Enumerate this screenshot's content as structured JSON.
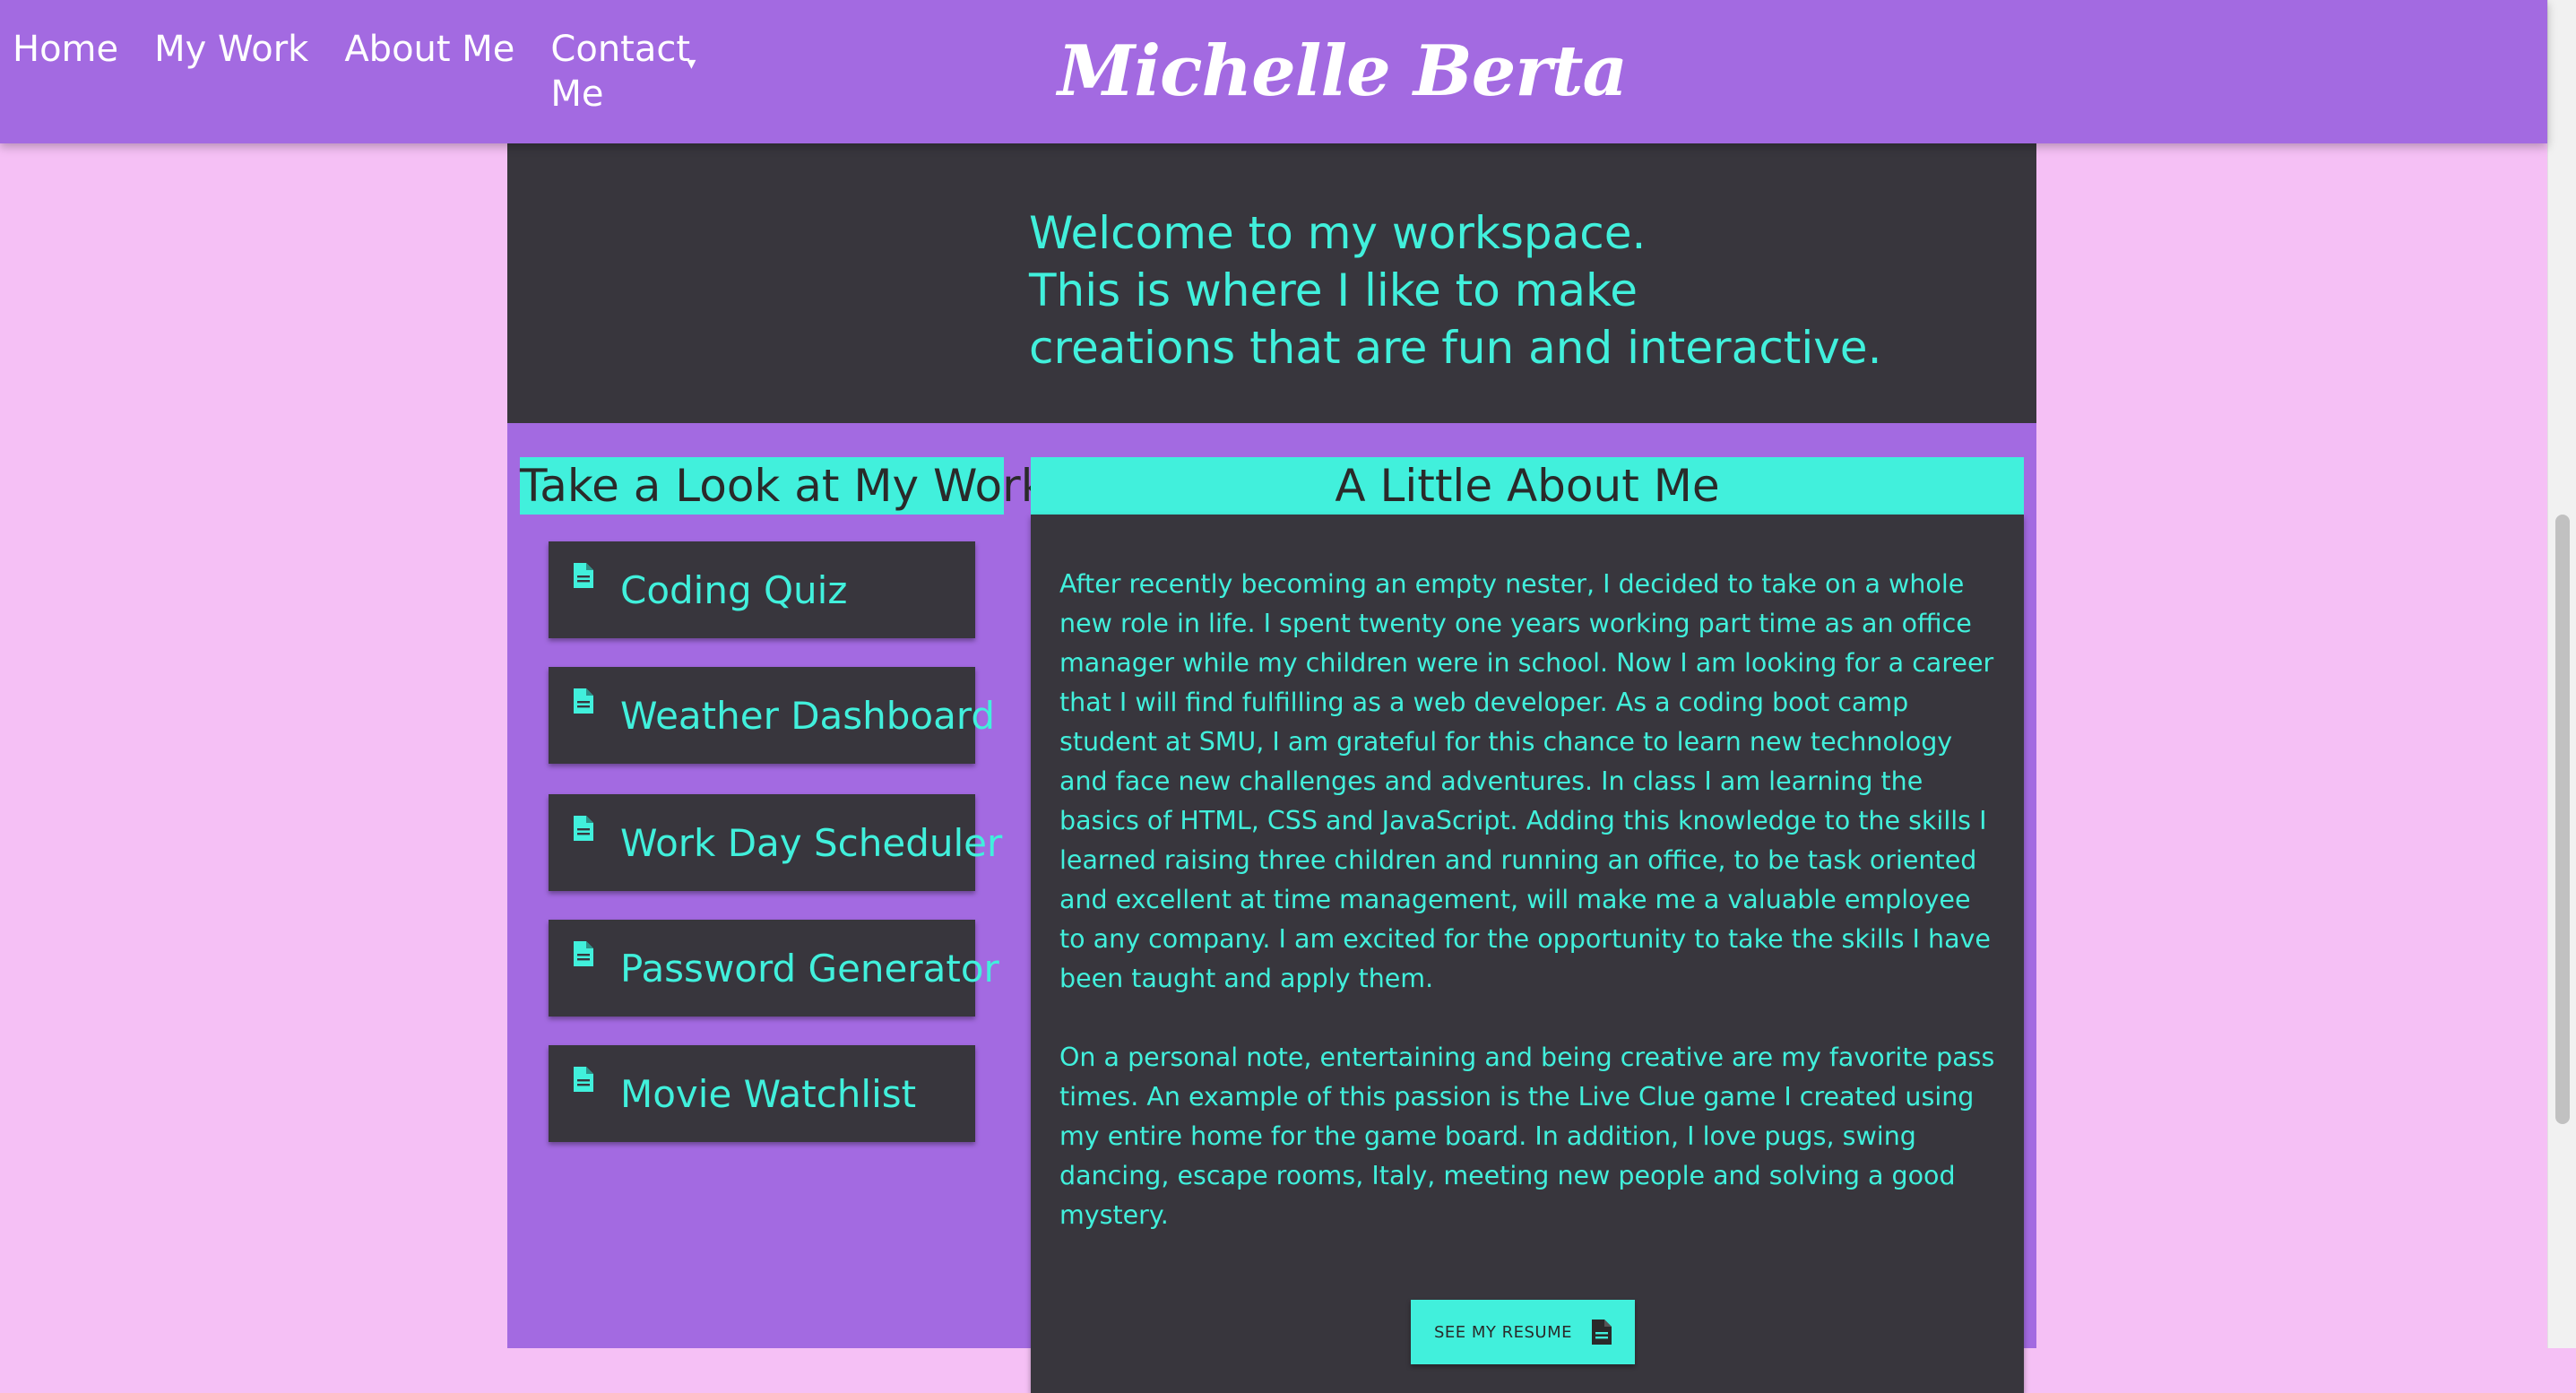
{
  "nav": {
    "links": [
      "Home",
      "My Work",
      "About Me",
      "Contact Me"
    ],
    "dropdown_icon": "caret-down-icon",
    "brand": "Michelle Berta"
  },
  "hero": {
    "lines": [
      "Welcome to my workspace.",
      "This is where I like to make",
      "creations that are fun and interactive."
    ]
  },
  "work": {
    "title": "Take a Look at My Work",
    "items": [
      {
        "label": "Coding Quiz",
        "icon": "document-icon"
      },
      {
        "label": "Weather Dashboard",
        "icon": "document-icon"
      },
      {
        "label": "Work Day Scheduler",
        "icon": "document-icon"
      },
      {
        "label": "Password Generator",
        "icon": "document-icon"
      },
      {
        "label": "Movie Watchlist",
        "icon": "document-icon"
      }
    ]
  },
  "about": {
    "title": "A Little About Me",
    "paragraphs": [
      "After recently becoming an empty nester, I decided to take on a whole new role in life. I spent twenty one years working part time as an office manager while my children were in school. Now I am looking for a career that I will find fulfilling as a web developer. As a coding boot camp student at SMU, I am grateful for this chance to learn new technology and face new challenges and adventures. In class I am learning the basics of HTML, CSS and JavaScript. Adding this knowledge to the skills I learned raising three children and running an office, to be task oriented and excellent at time management, will make me a valuable employee to any company. I am excited for the opportunity to take the skills I have been taught and apply them.",
      "On a personal note, entertaining and being creative are my favorite pass times. An example of this passion is the Live Clue game I created using my entire home for the game board. In addition, I love pugs, swing dancing, escape rooms, Italy, meeting new people and solving a good mystery."
    ],
    "resume_button": "SEE MY RESUME",
    "resume_icon": "document-icon"
  },
  "colors": {
    "page_background": "#f5c0f5",
    "purple": "#a36ae1",
    "dark": "#38363d",
    "accent": "#41f0dc"
  }
}
